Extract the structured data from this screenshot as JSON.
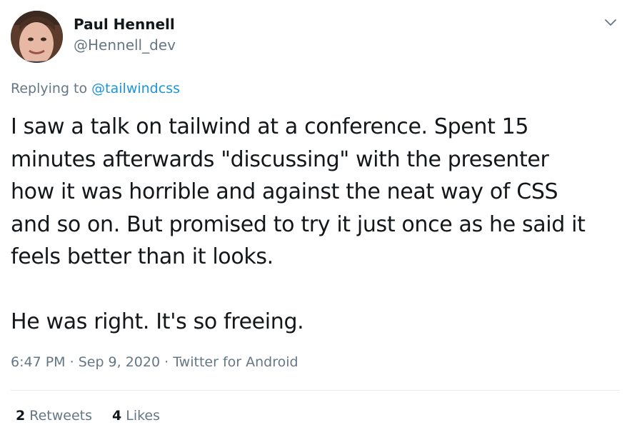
{
  "author": {
    "name": "Paul Hennell",
    "handle": "@Hennell_dev",
    "avatar_icon": "profile-photo"
  },
  "reply": {
    "prefix": "Replying to",
    "target": "@tailwindcss"
  },
  "tweet": {
    "lines": [
      "I saw a talk on tailwind at a conference. Spent 15",
      "minutes afterwards \"discussing\" with the presenter",
      "how it was horrible and against the neat way of CSS",
      "and so on. But promised to try it just once as he said it",
      "feels better than it looks."
    ],
    "closing": "He was right. It's so freeing."
  },
  "meta": {
    "time": "6:47 PM",
    "sep1": "·",
    "date": "Sep 9, 2020",
    "sep2": "·",
    "source": "Twitter for Android"
  },
  "stats": {
    "retweets_count": "2",
    "retweets_label": "Retweets",
    "likes_count": "4",
    "likes_label": "Likes"
  },
  "colors": {
    "link": "#1b95e0",
    "secondary_text": "#657786",
    "primary_text": "#14171a",
    "divider": "#e6ecf0"
  }
}
